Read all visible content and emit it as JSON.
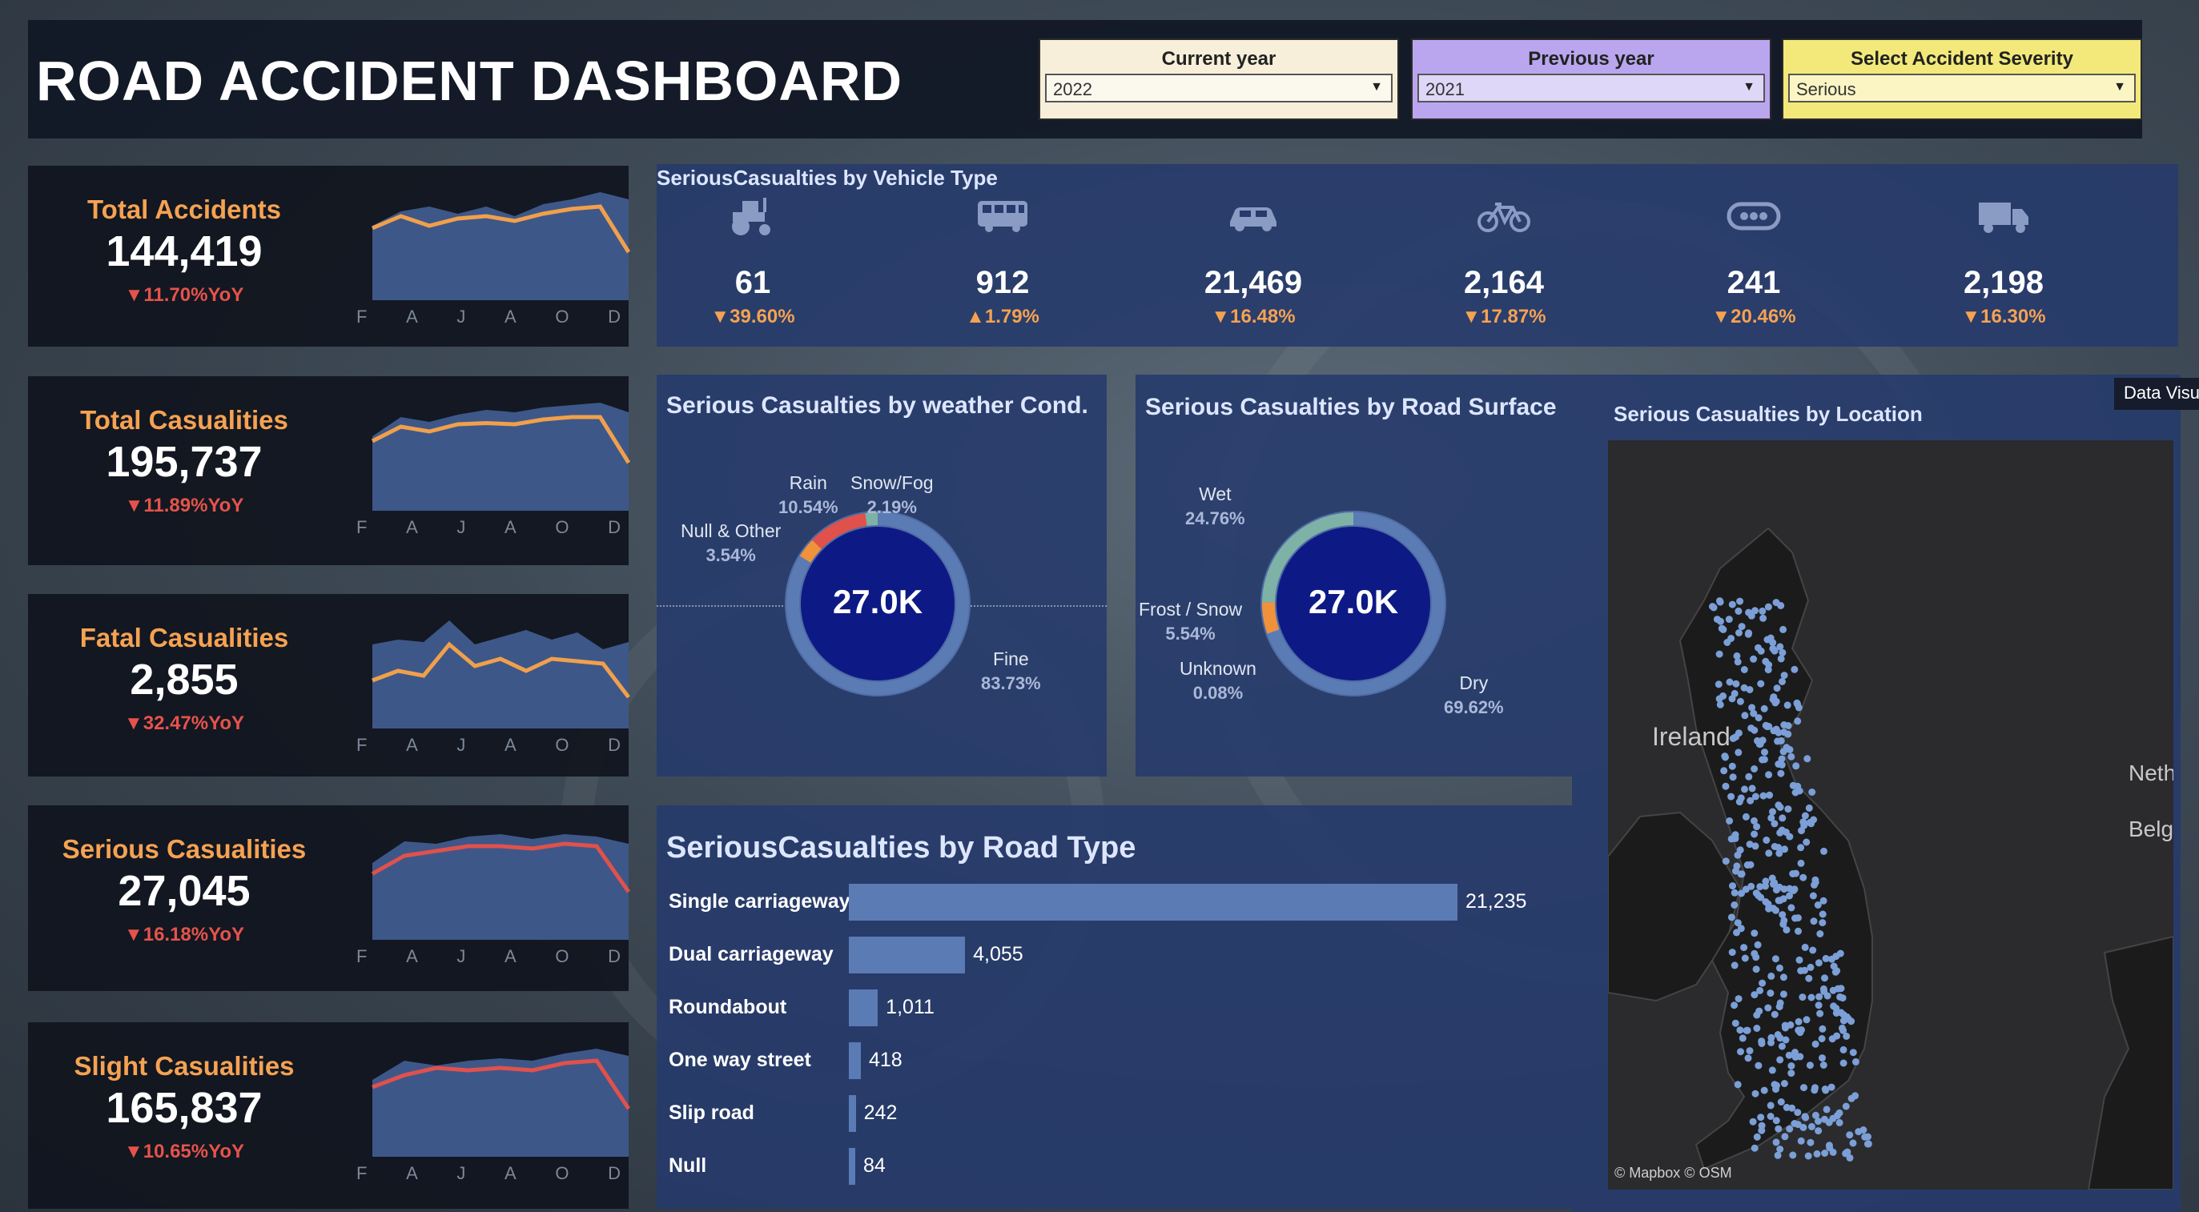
{
  "header": {
    "title": "ROAD ACCIDENT DASHBOARD",
    "filters": [
      {
        "label": "Current year",
        "value": "2022",
        "color": "#f7efd9"
      },
      {
        "label": "Previous year",
        "value": "2021",
        "color": "#b9a6ee"
      },
      {
        "label": "Select Accident Severity",
        "value": "Serious",
        "color": "#f3e97a"
      }
    ]
  },
  "kpis": [
    {
      "label": "Total Accidents",
      "value": "144,419",
      "yoy": "▼11.70%YoY",
      "trend": [
        60,
        70,
        62,
        68,
        70,
        66,
        72,
        76,
        78,
        40
      ],
      "area": [
        62,
        74,
        78,
        72,
        78,
        70,
        80,
        84,
        90,
        84
      ],
      "line_color": "#f0a04b"
    },
    {
      "label": "Total Casualities",
      "value": "195,737",
      "yoy": "▼11.89%YoY",
      "trend": [
        58,
        70,
        66,
        72,
        73,
        72,
        76,
        78,
        78,
        40
      ],
      "area": [
        62,
        78,
        74,
        80,
        84,
        82,
        86,
        88,
        90,
        82
      ],
      "line_color": "#f0a04b"
    },
    {
      "label": "Fatal Casualities",
      "value": "2,855",
      "yoy": "▼32.47%YoY",
      "trend": [
        40,
        48,
        44,
        70,
        52,
        58,
        48,
        58,
        56,
        54,
        26
      ],
      "area": [
        70,
        74,
        72,
        90,
        70,
        76,
        82,
        74,
        80,
        66,
        72
      ],
      "line_color": "#f0a04b"
    },
    {
      "label": "Serious Casualities",
      "value": "27,045",
      "yoy": "▼16.18%YoY",
      "trend": [
        55,
        70,
        74,
        78,
        78,
        76,
        80,
        78,
        40
      ],
      "area": [
        64,
        82,
        80,
        86,
        88,
        84,
        88,
        86,
        80
      ],
      "line_color": "#e0514c"
    },
    {
      "label": "Slight Casualities",
      "value": "165,837",
      "yoy": "▼10.65%YoY",
      "trend": [
        58,
        68,
        74,
        72,
        74,
        72,
        78,
        80,
        40
      ],
      "area": [
        64,
        80,
        76,
        80,
        82,
        80,
        86,
        90,
        84
      ],
      "line_color": "#e0514c"
    }
  ],
  "months": [
    "F",
    "A",
    "J",
    "A",
    "O",
    "D"
  ],
  "vehicle": {
    "title": "SeriousCasualties by Vehicle Type",
    "items": [
      {
        "icon": "tractor-icon",
        "value": "61",
        "change": "▼39.60%"
      },
      {
        "icon": "bus-icon",
        "value": "912",
        "change": "▲1.79%"
      },
      {
        "icon": "car-icon",
        "value": "21,469",
        "change": "▼16.48%"
      },
      {
        "icon": "bicycle-icon",
        "value": "2,164",
        "change": "▼17.87%"
      },
      {
        "icon": "other-vehicle-icon",
        "value": "241",
        "change": "▼20.46%"
      },
      {
        "icon": "truck-icon",
        "value": "2,198",
        "change": "▼16.30%"
      }
    ]
  },
  "weather": {
    "title": "Serious Casualties by weather Cond.",
    "center": "27.0K",
    "slices": [
      {
        "name": "Fine",
        "pct": "83.73%",
        "value": 83.73,
        "color": "#5b7bb5"
      },
      {
        "name": "Null & Other",
        "pct": "3.54%",
        "value": 3.54,
        "color": "#f0923b"
      },
      {
        "name": "Rain",
        "pct": "10.54%",
        "value": 10.54,
        "color": "#e0514c"
      },
      {
        "name": "Snow/Fog",
        "pct": "2.19%",
        "value": 2.19,
        "color": "#7fb2a6"
      }
    ]
  },
  "surface": {
    "title": "Serious Casualties by Road Surface",
    "center": "27.0K",
    "slices": [
      {
        "name": "Dry",
        "pct": "69.62%",
        "value": 69.62,
        "color": "#5b7bb5"
      },
      {
        "name": "Unknown",
        "pct": "0.08%",
        "value": 0.08,
        "color": "#9aa9d0"
      },
      {
        "name": "Frost / Snow",
        "pct": "5.54%",
        "value": 5.54,
        "color": "#f0923b"
      },
      {
        "name": "Wet",
        "pct": "24.76%",
        "value": 24.76,
        "color": "#7fb2a6"
      }
    ]
  },
  "roadtype": {
    "title": "SeriousCasualties by Road Type",
    "rows": [
      {
        "name": "Single carriageway",
        "value": 21235,
        "label": "21,235"
      },
      {
        "name": "Dual carriageway",
        "value": 4055,
        "label": "4,055"
      },
      {
        "name": "Roundabout",
        "value": 1011,
        "label": "1,011"
      },
      {
        "name": "One way street",
        "value": 418,
        "label": "418"
      },
      {
        "name": "Slip road",
        "value": 242,
        "label": "242"
      },
      {
        "name": "Null",
        "value": 84,
        "label": "84"
      }
    ]
  },
  "map": {
    "title": "Serious  Casualties by Location",
    "labels": {
      "ireland": "Ireland",
      "neth": "Neth",
      "belg": "Belg"
    },
    "attribution": "© Mapbox  © OSM"
  },
  "data_vis_tab": "Data Visu"
}
